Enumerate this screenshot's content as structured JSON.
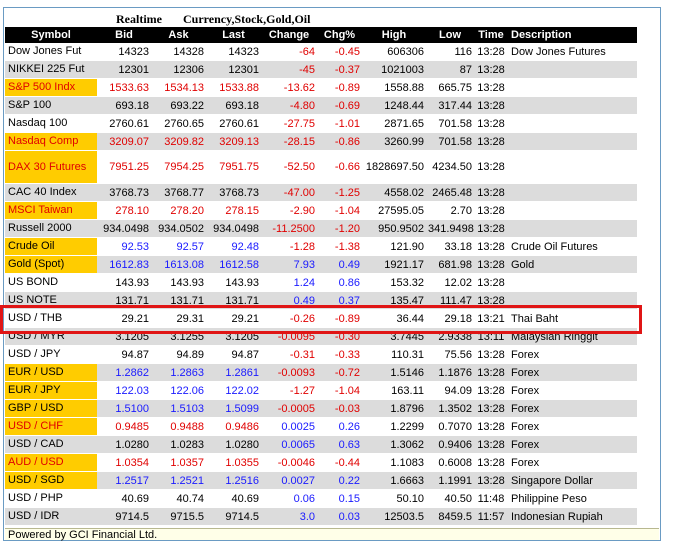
{
  "title": {
    "realtime": "Realtime",
    "categories": "Currency,Stock,Gold,Oil"
  },
  "headers": [
    "Symbol",
    "Bid",
    "Ask",
    "Last",
    "Change",
    "Chg%",
    "High",
    "Low",
    "Time",
    "Description"
  ],
  "rows": [
    {
      "symbol": "Dow Jones Fut",
      "bid": "14323",
      "ask": "14328",
      "last": "14323",
      "change": "-64",
      "chg": "-0.45",
      "high": "606306",
      "low": "116",
      "time": "13:28",
      "desc": "Dow Jones Futures",
      "hl": false,
      "color": "black",
      "dir": "red"
    },
    {
      "symbol": "NIKKEI 225 Fut",
      "bid": "12301",
      "ask": "12306",
      "last": "12301",
      "change": "-45",
      "chg": "-0.37",
      "high": "1021003",
      "low": "87",
      "time": "13:28",
      "desc": "",
      "hl": false,
      "color": "black",
      "dir": "red"
    },
    {
      "symbol": "S&P 500 Indx",
      "bid": "1533.63",
      "ask": "1534.13",
      "last": "1533.88",
      "change": "-13.62",
      "chg": "-0.89",
      "high": "1558.88",
      "low": "665.75",
      "time": "13:28",
      "desc": "",
      "hl": true,
      "color": "red",
      "dir": "red"
    },
    {
      "symbol": "S&P 100",
      "bid": "693.18",
      "ask": "693.22",
      "last": "693.18",
      "change": "-4.80",
      "chg": "-0.69",
      "high": "1248.44",
      "low": "317.44",
      "time": "13:28",
      "desc": "",
      "hl": false,
      "color": "black",
      "dir": "red"
    },
    {
      "symbol": "Nasdaq 100",
      "bid": "2760.61",
      "ask": "2760.65",
      "last": "2760.61",
      "change": "-27.75",
      "chg": "-1.01",
      "high": "2871.65",
      "low": "701.58",
      "time": "13:28",
      "desc": "",
      "hl": false,
      "color": "black",
      "dir": "red"
    },
    {
      "symbol": "Nasdaq Comp",
      "bid": "3209.07",
      "ask": "3209.82",
      "last": "3209.13",
      "change": "-28.15",
      "chg": "-0.86",
      "high": "3260.99",
      "low": "701.58",
      "time": "13:28",
      "desc": "",
      "hl": true,
      "color": "red",
      "dir": "red"
    },
    {
      "symbol": "DAX 30 Futures",
      "bid": "7951.25",
      "ask": "7954.25",
      "last": "7951.75",
      "change": "-52.50",
      "chg": "-0.66",
      "high": "1828697.50",
      "low": "4234.50",
      "time": "13:28",
      "desc": "",
      "hl": true,
      "color": "red",
      "dir": "red",
      "tall": true
    },
    {
      "symbol": "CAC 40 Index",
      "bid": "3768.73",
      "ask": "3768.77",
      "last": "3768.73",
      "change": "-47.00",
      "chg": "-1.25",
      "high": "4558.02",
      "low": "2465.48",
      "time": "13:28",
      "desc": "",
      "hl": false,
      "color": "black",
      "dir": "red"
    },
    {
      "symbol": "MSCI Taiwan",
      "bid": "278.10",
      "ask": "278.20",
      "last": "278.15",
      "change": "-2.90",
      "chg": "-1.04",
      "high": "27595.05",
      "low": "2.70",
      "time": "13:28",
      "desc": "",
      "hl": true,
      "color": "red",
      "dir": "red"
    },
    {
      "symbol": "Russell 2000",
      "bid": "934.0498",
      "ask": "934.0502",
      "last": "934.0498",
      "change": "-11.2500",
      "chg": "-1.20",
      "high": "950.9502",
      "low": "341.9498",
      "time": "13:28",
      "desc": "",
      "hl": false,
      "color": "black",
      "dir": "red"
    },
    {
      "symbol": "Crude Oil",
      "bid": "92.53",
      "ask": "92.57",
      "last": "92.48",
      "change": "-1.28",
      "chg": "-1.38",
      "high": "121.90",
      "low": "33.18",
      "time": "13:28",
      "desc": "Crude Oil Futures",
      "hl": true,
      "color": "blue",
      "dir": "red"
    },
    {
      "symbol": "Gold (Spot)",
      "bid": "1612.83",
      "ask": "1613.08",
      "last": "1612.58",
      "change": "7.93",
      "chg": "0.49",
      "high": "1921.17",
      "low": "681.98",
      "time": "13:28",
      "desc": "Gold",
      "hl": true,
      "color": "blue",
      "dir": "blue"
    },
    {
      "symbol": "US BOND",
      "bid": "143.93",
      "ask": "143.93",
      "last": "143.93",
      "change": "1.24",
      "chg": "0.86",
      "high": "153.32",
      "low": "12.02",
      "time": "13:28",
      "desc": "",
      "hl": false,
      "color": "black",
      "dir": "blue"
    },
    {
      "symbol": "US NOTE",
      "bid": "131.71",
      "ask": "131.71",
      "last": "131.71",
      "change": "0.49",
      "chg": "0.37",
      "high": "135.47",
      "low": "111.47",
      "time": "13:28",
      "desc": "",
      "hl": false,
      "color": "black",
      "dir": "blue"
    },
    {
      "symbol": "USD / THB",
      "bid": "29.21",
      "ask": "29.31",
      "last": "29.21",
      "change": "-0.26",
      "chg": "-0.89",
      "high": "36.44",
      "low": "29.18",
      "time": "13:21",
      "desc": "Thai Baht",
      "hl": false,
      "color": "black",
      "dir": "red"
    },
    {
      "symbol": "USD / MYR",
      "bid": "3.1205",
      "ask": "3.1255",
      "last": "3.1205",
      "change": "-0.0095",
      "chg": "-0.30",
      "high": "3.7445",
      "low": "2.9338",
      "time": "13:11",
      "desc": "Malaysian Ringgit",
      "hl": false,
      "color": "black",
      "dir": "red"
    },
    {
      "symbol": "USD / JPY",
      "bid": "94.87",
      "ask": "94.89",
      "last": "94.87",
      "change": "-0.31",
      "chg": "-0.33",
      "high": "110.31",
      "low": "75.56",
      "time": "13:28",
      "desc": "Forex",
      "hl": false,
      "color": "black",
      "dir": "red"
    },
    {
      "symbol": "EUR / USD",
      "bid": "1.2862",
      "ask": "1.2863",
      "last": "1.2861",
      "change": "-0.0093",
      "chg": "-0.72",
      "high": "1.5146",
      "low": "1.1876",
      "time": "13:28",
      "desc": "Forex",
      "hl": true,
      "color": "blue",
      "dir": "red"
    },
    {
      "symbol": "EUR / JPY",
      "bid": "122.03",
      "ask": "122.06",
      "last": "122.02",
      "change": "-1.27",
      "chg": "-1.04",
      "high": "163.11",
      "low": "94.09",
      "time": "13:28",
      "desc": "Forex",
      "hl": true,
      "color": "blue",
      "dir": "red"
    },
    {
      "symbol": "GBP / USD",
      "bid": "1.5100",
      "ask": "1.5103",
      "last": "1.5099",
      "change": "-0.0005",
      "chg": "-0.03",
      "high": "1.8796",
      "low": "1.3502",
      "time": "13:28",
      "desc": "Forex",
      "hl": true,
      "color": "blue",
      "dir": "red"
    },
    {
      "symbol": "USD / CHF",
      "bid": "0.9485",
      "ask": "0.9488",
      "last": "0.9486",
      "change": "0.0025",
      "chg": "0.26",
      "high": "1.2299",
      "low": "0.7070",
      "time": "13:28",
      "desc": "Forex",
      "hl": true,
      "color": "red",
      "dir": "blue"
    },
    {
      "symbol": "USD / CAD",
      "bid": "1.0280",
      "ask": "1.0283",
      "last": "1.0280",
      "change": "0.0065",
      "chg": "0.63",
      "high": "1.3062",
      "low": "0.9406",
      "time": "13:28",
      "desc": "Forex",
      "hl": false,
      "color": "black",
      "dir": "blue"
    },
    {
      "symbol": "AUD / USD",
      "bid": "1.0354",
      "ask": "1.0357",
      "last": "1.0355",
      "change": "-0.0046",
      "chg": "-0.44",
      "high": "1.1083",
      "low": "0.6008",
      "time": "13:28",
      "desc": "Forex",
      "hl": true,
      "color": "red",
      "dir": "red"
    },
    {
      "symbol": "USD / SGD",
      "bid": "1.2517",
      "ask": "1.2521",
      "last": "1.2516",
      "change": "0.0027",
      "chg": "0.22",
      "high": "1.6663",
      "low": "1.1991",
      "time": "13:28",
      "desc": "Singapore Dollar",
      "hl": true,
      "color": "blue",
      "dir": "blue"
    },
    {
      "symbol": "USD / PHP",
      "bid": "40.69",
      "ask": "40.74",
      "last": "40.69",
      "change": "0.06",
      "chg": "0.15",
      "high": "50.10",
      "low": "40.50",
      "time": "11:48",
      "desc": "Philippine Peso",
      "hl": false,
      "color": "black",
      "dir": "blue"
    },
    {
      "symbol": "USD / IDR",
      "bid": "9714.5",
      "ask": "9715.5",
      "last": "9714.5",
      "change": "3.0",
      "chg": "0.03",
      "high": "12503.5",
      "low": "8459.5",
      "time": "11:57",
      "desc": "Indonesian Rupiah",
      "hl": false,
      "color": "black",
      "dir": "blue"
    }
  ],
  "footer": "Powered by GCI Financial Ltd.",
  "colors": {
    "highlight_symbol": "#ffcc00",
    "header_bg": "#000000",
    "row_alt": "#dcdcdc",
    "up": "#1a1aff",
    "down": "#e00000",
    "callout": "#e01515"
  }
}
